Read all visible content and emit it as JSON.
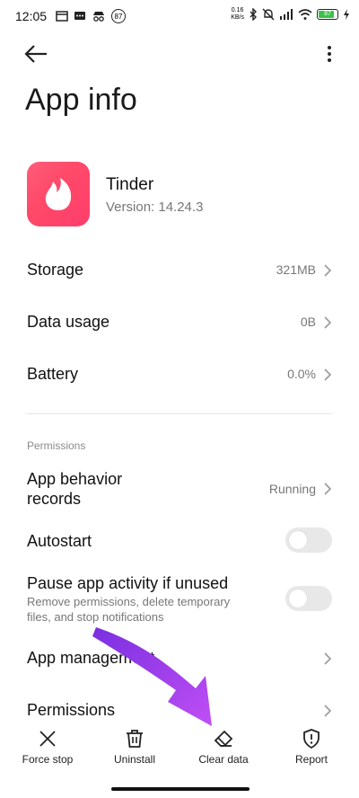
{
  "status_bar": {
    "time": "12:05",
    "badge": "87",
    "speed_top": "0.16",
    "speed_unit": "KB/s",
    "battery": "87",
    "colors": {
      "battery_fill": "#3cc24a"
    }
  },
  "header": {
    "back_icon": "arrow-left-icon",
    "more_icon": "more-vertical-icon",
    "title": "App info"
  },
  "app": {
    "name": "Tinder",
    "version": "Version: 14.24.3",
    "icon": "tinder-flame-icon",
    "colors": {
      "icon_bg": "#ff4a6a"
    }
  },
  "rows": [
    {
      "label": "Storage",
      "value": "321MB"
    },
    {
      "label": "Data usage",
      "value": "0B"
    },
    {
      "label": "Battery",
      "value": "0.0%"
    }
  ],
  "permissions_section": {
    "header": "Permissions",
    "behavior": {
      "label_line1": "App behavior",
      "label_line2": "records",
      "value": "Running"
    },
    "autostart": {
      "label": "Autostart",
      "enabled": false
    },
    "pause": {
      "label": "Pause app activity if unused",
      "desc_line1": "Remove permissions, delete temporary",
      "desc_line2": "files, and stop notifications",
      "enabled": false
    },
    "app_management": "App management",
    "permissions": "Permissions"
  },
  "bottom_bar": {
    "items": [
      {
        "label": "Force stop",
        "icon": "close-icon"
      },
      {
        "label": "Uninstall",
        "icon": "trash-icon"
      },
      {
        "label": "Clear data",
        "icon": "eraser-icon"
      },
      {
        "label": "Report",
        "icon": "shield-alert-icon"
      }
    ]
  },
  "annotation": {
    "arrow_color": "#a23ff0"
  }
}
